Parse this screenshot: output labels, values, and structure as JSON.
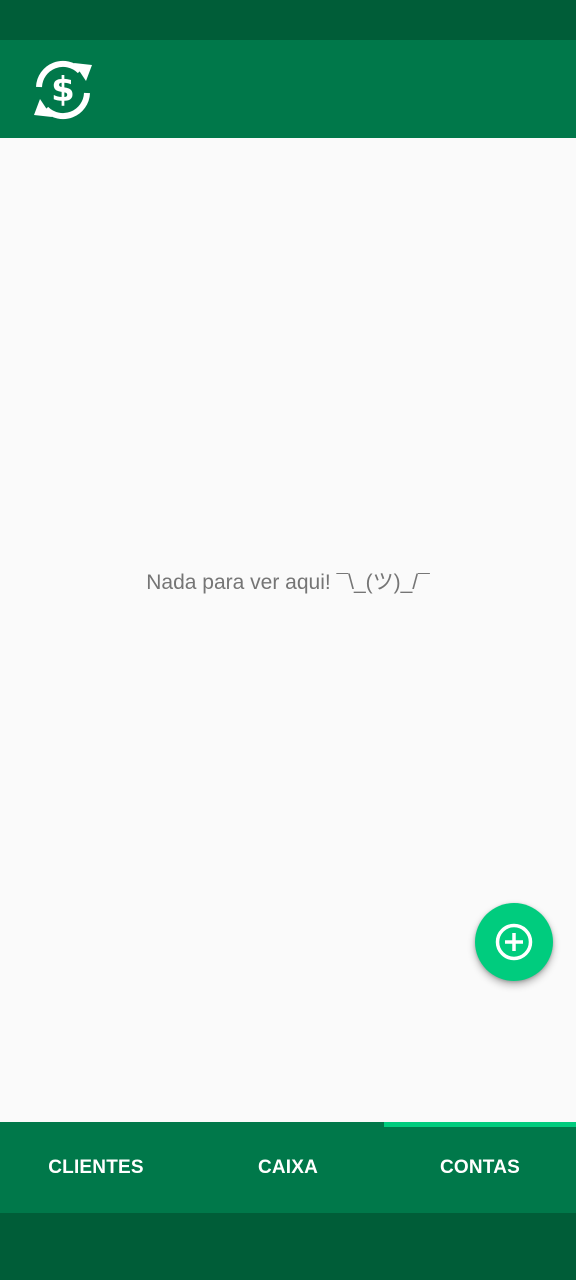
{
  "app": {
    "logo_icon": "dollar-sync-icon",
    "colors": {
      "status_bar": "#005d38",
      "app_bar": "#00784a",
      "accent": "#00cc7e",
      "background": "#fafafa",
      "empty_text": "#757575"
    }
  },
  "content": {
    "empty_message": "Nada para ver aqui! ¯\\_(ツ)_/¯"
  },
  "fab": {
    "icon": "add-circle-icon"
  },
  "tabs": [
    {
      "label": "CLIENTES",
      "selected": false
    },
    {
      "label": "CAIXA",
      "selected": false
    },
    {
      "label": "CONTAS",
      "selected": true
    }
  ]
}
